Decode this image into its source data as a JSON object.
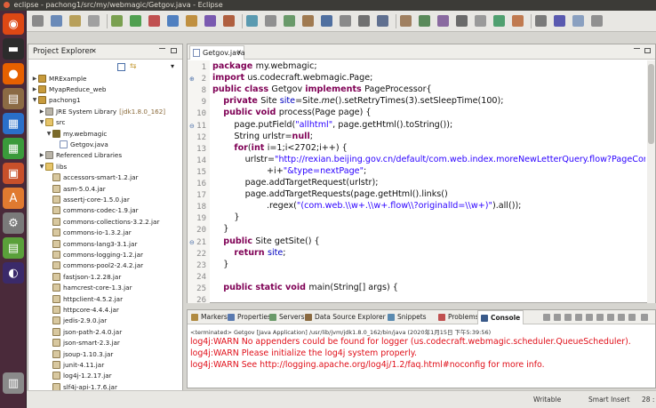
{
  "window": {
    "title": "eclipse - pachong1/src/my/webmagic/Getgov.java - Eclipse"
  },
  "launcher": {
    "items": [
      "ubuntu-dash-icon",
      "terminal-icon",
      "firefox-icon",
      "files-icon",
      "writer-icon",
      "calc-icon",
      "impress-icon",
      "software-center-icon",
      "settings-icon",
      "libreoffice-icon",
      "eclipse-icon",
      "trash-icon"
    ]
  },
  "package_explorer": {
    "title": "Project Explorer",
    "tree": [
      {
        "label": "MRExample",
        "indent": 0,
        "expanded": false,
        "kind": "proj"
      },
      {
        "label": "MyapReduce_web",
        "indent": 0,
        "expanded": false,
        "kind": "proj"
      },
      {
        "label": "pachong1",
        "indent": 0,
        "expanded": true,
        "kind": "proj"
      },
      {
        "label": "JRE System Library",
        "suffix": "[jdk1.8.0_162]",
        "indent": 1,
        "expanded": false,
        "kind": "lib"
      },
      {
        "label": "src",
        "indent": 1,
        "expanded": true,
        "kind": "folder"
      },
      {
        "label": "my.webmagic",
        "indent": 2,
        "expanded": true,
        "kind": "pkg"
      },
      {
        "label": "Getgov.java",
        "indent": 3,
        "expanded": false,
        "kind": "file"
      },
      {
        "label": "Referenced Libraries",
        "indent": 1,
        "expanded": false,
        "kind": "lib"
      },
      {
        "label": "libs",
        "indent": 1,
        "expanded": true,
        "kind": "folder"
      },
      {
        "label": "accessors-smart-1.2.jar",
        "indent": 2,
        "kind": "jar"
      },
      {
        "label": "asm-5.0.4.jar",
        "indent": 2,
        "kind": "jar"
      },
      {
        "label": "assertj-core-1.5.0.jar",
        "indent": 2,
        "kind": "jar"
      },
      {
        "label": "commons-codec-1.9.jar",
        "indent": 2,
        "kind": "jar"
      },
      {
        "label": "commons-collections-3.2.2.jar",
        "indent": 2,
        "kind": "jar"
      },
      {
        "label": "commons-io-1.3.2.jar",
        "indent": 2,
        "kind": "jar"
      },
      {
        "label": "commons-lang3-3.1.jar",
        "indent": 2,
        "kind": "jar"
      },
      {
        "label": "commons-logging-1.2.jar",
        "indent": 2,
        "kind": "jar"
      },
      {
        "label": "commons-pool2-2.4.2.jar",
        "indent": 2,
        "kind": "jar"
      },
      {
        "label": "fastjson-1.2.28.jar",
        "indent": 2,
        "kind": "jar"
      },
      {
        "label": "hamcrest-core-1.3.jar",
        "indent": 2,
        "kind": "jar"
      },
      {
        "label": "httpclient-4.5.2.jar",
        "indent": 2,
        "kind": "jar"
      },
      {
        "label": "httpcore-4.4.4.jar",
        "indent": 2,
        "kind": "jar"
      },
      {
        "label": "jedis-2.9.0.jar",
        "indent": 2,
        "kind": "jar"
      },
      {
        "label": "json-path-2.4.0.jar",
        "indent": 2,
        "kind": "jar"
      },
      {
        "label": "json-smart-2.3.jar",
        "indent": 2,
        "kind": "jar"
      },
      {
        "label": "jsoup-1.10.3.jar",
        "indent": 2,
        "kind": "jar"
      },
      {
        "label": "junit-4.11.jar",
        "indent": 2,
        "kind": "jar"
      },
      {
        "label": "log4j-1.2.17.jar",
        "indent": 2,
        "kind": "jar"
      },
      {
        "label": "slf4j-api-1.7.6.jar",
        "indent": 2,
        "kind": "jar"
      }
    ]
  },
  "editor": {
    "tab_label": "Getgov.java",
    "line_numbers": [
      "1",
      "2",
      "8",
      "9",
      "10",
      "11",
      "12",
      "13",
      "14",
      "15",
      "16",
      "17",
      "18",
      "19",
      "20",
      "21",
      "22",
      "23",
      "24",
      "25",
      "26"
    ],
    "fold_markers": {
      "2": "+",
      "11": "-",
      "21": "-"
    },
    "lines": [
      {
        "parts": [
          [
            "kw",
            "package "
          ],
          [
            "",
            "my.webmagic;"
          ]
        ]
      },
      {
        "parts": [
          [
            "kw",
            "import "
          ],
          [
            "",
            "us.codecraft.webmagic.Page;"
          ]
        ]
      },
      {
        "parts": [
          [
            "kw",
            "public class "
          ],
          [
            "",
            "Getgov "
          ],
          [
            "kw",
            "implements "
          ],
          [
            "",
            "PageProcessor{"
          ]
        ]
      },
      {
        "parts": [
          [
            "",
            "    "
          ],
          [
            "kw",
            "private "
          ],
          [
            "",
            "Site "
          ],
          [
            "fld",
            "site"
          ],
          [
            "",
            "=Site."
          ],
          [
            "it",
            "me"
          ],
          [
            "",
            "().setRetryTimes(3).setSleepTime(100);"
          ]
        ]
      },
      {
        "parts": [
          [
            "",
            "    "
          ],
          [
            "kw",
            "public void "
          ],
          [
            "",
            "process(Page page) {"
          ]
        ]
      },
      {
        "parts": [
          [
            "",
            "        page.putField("
          ],
          [
            "str",
            "\"allhtml\""
          ],
          [
            "",
            ", page.getHtml().toString());"
          ]
        ]
      },
      {
        "parts": [
          [
            "",
            "        String urlstr="
          ],
          [
            "kw",
            "null"
          ],
          [
            "",
            ";"
          ]
        ]
      },
      {
        "parts": [
          [
            "",
            "        "
          ],
          [
            "kw",
            "for"
          ],
          [
            "",
            "("
          ],
          [
            "kw",
            "int "
          ],
          [
            "",
            "i=1;i<2702;i++) {"
          ]
        ]
      },
      {
        "parts": [
          [
            "",
            "            urlstr="
          ],
          [
            "str",
            "\"http://rexian.beijing.gov.cn/default/com.web.index.moreNewLetterQuery.flow?PageCond/cur"
          ]
        ]
      },
      {
        "parts": [
          [
            "",
            "                    +i+"
          ],
          [
            "str",
            "\"&type=nextPage\""
          ],
          [
            "",
            ";"
          ]
        ]
      },
      {
        "parts": [
          [
            "",
            "            page.addTargetRequest(urlstr);"
          ]
        ]
      },
      {
        "parts": [
          [
            "",
            "            page.addTargetRequests(page.getHtml().links()"
          ]
        ]
      },
      {
        "parts": [
          [
            "",
            "                    .regex("
          ],
          [
            "str",
            "\"(com.web.\\\\w+.\\\\w+.flow\\\\?originalId=\\\\w+)\""
          ],
          [
            "",
            ").all());"
          ]
        ]
      },
      {
        "parts": [
          [
            "",
            "        }"
          ]
        ]
      },
      {
        "parts": [
          [
            "",
            "    }"
          ]
        ]
      },
      {
        "parts": [
          [
            "",
            "    "
          ],
          [
            "kw",
            "public "
          ],
          [
            "",
            "Site getSite() {"
          ]
        ]
      },
      {
        "parts": [
          [
            "",
            "        "
          ],
          [
            "kw",
            "return "
          ],
          [
            "fld",
            "site"
          ],
          [
            "",
            ";"
          ]
        ]
      },
      {
        "parts": [
          [
            "",
            "    }"
          ]
        ]
      },
      {
        "parts": [
          [
            "",
            ""
          ]
        ]
      },
      {
        "parts": [
          [
            "",
            "    "
          ],
          [
            "kw",
            "public static void "
          ],
          [
            "",
            "main(String[] args) {"
          ]
        ]
      },
      {
        "parts": [
          [
            "",
            ""
          ]
        ]
      }
    ]
  },
  "bottom_panel": {
    "tabs": [
      "Markers",
      "Properties",
      "Servers",
      "Data Source Explorer",
      "Snippets",
      "Problems",
      "Console"
    ],
    "active_tab": "Console",
    "console_status": "<terminated> Getgov [Java Application] /usr/lib/jvm/jdk1.8.0_162/bin/java (2020年1月15日 下午5:39:56)",
    "console_lines": [
      "log4j:WARN No appenders could be found for logger (us.codecraft.webmagic.scheduler.QueueScheduler).",
      "log4j:WARN Please initialize the log4j system properly.",
      "log4j:WARN See http://logging.apache.org/log4j/1.2/faq.html#noconfig for more info."
    ]
  },
  "status_bar": {
    "writable": "Writable",
    "insert_mode": "Smart Insert",
    "position": "28 : "
  },
  "colors": {
    "keyword": "#7f0055",
    "string": "#2a00ff",
    "field": "#0000c0",
    "console_error": "#e0101a",
    "launcher": "#4a2a3a"
  }
}
